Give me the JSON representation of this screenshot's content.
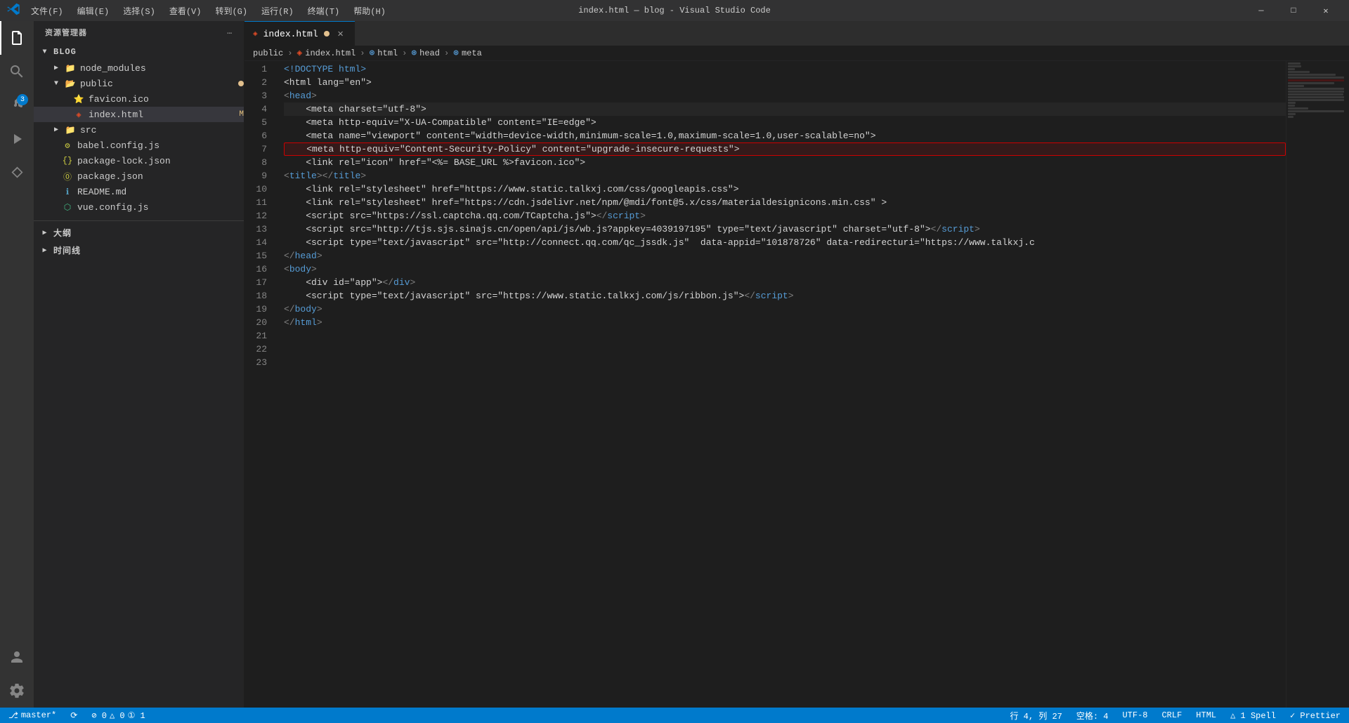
{
  "titleBar": {
    "title": "index.html — blog - Visual Studio Code",
    "menu": [
      "文件(F)",
      "编辑(E)",
      "选择(S)",
      "查看(V)",
      "转到(G)",
      "运行(R)",
      "终端(T)",
      "帮助(H)"
    ],
    "controls": [
      "🗗",
      "❐",
      "✕"
    ]
  },
  "sidebar": {
    "header": "资源管理器",
    "sections": {
      "blog": {
        "label": "BLOG",
        "items": [
          {
            "name": "node_modules",
            "type": "folder",
            "collapsed": true,
            "indent": 1
          },
          {
            "name": "public",
            "type": "folder",
            "collapsed": false,
            "indent": 1,
            "modified": true
          },
          {
            "name": "favicon.ico",
            "type": "file-star",
            "indent": 2
          },
          {
            "name": "index.html",
            "type": "file-html",
            "indent": 2,
            "badge": "M",
            "active": true
          },
          {
            "name": "src",
            "type": "folder",
            "collapsed": true,
            "indent": 1
          },
          {
            "name": "babel.config.js",
            "type": "file-js",
            "indent": 1
          },
          {
            "name": "package-lock.json",
            "type": "file-json",
            "indent": 1
          },
          {
            "name": "package.json",
            "type": "file-json",
            "indent": 1
          },
          {
            "name": "README.md",
            "type": "file-md",
            "indent": 1
          },
          {
            "name": "vue.config.js",
            "type": "file-js",
            "indent": 1
          }
        ]
      }
    }
  },
  "tabs": [
    {
      "name": "index.html",
      "active": true,
      "modified": true,
      "icon": "html"
    }
  ],
  "breadcrumb": {
    "parts": [
      "public",
      "index.html",
      "html",
      "head",
      "meta"
    ]
  },
  "codeLines": [
    {
      "num": 1,
      "content": "<!DOCTYPE html>"
    },
    {
      "num": 2,
      "content": "<html lang=\"en\">"
    },
    {
      "num": 3,
      "content": "  <head>"
    },
    {
      "num": 4,
      "content": "    <meta charset=\"utf-8\">"
    },
    {
      "num": 5,
      "content": "    <meta http-equiv=\"X-UA-Compatible\" content=\"IE=edge\">"
    },
    {
      "num": 6,
      "content": "    <meta name=\"viewport\" content=\"width=device-width,minimum-scale=1.0,maximum-scale=1.0,user-scalable=no\">"
    },
    {
      "num": 7,
      "content": "    <meta http-equiv=\"Content-Security-Policy\" content=\"upgrade-insecure-requests\">",
      "highlight": true
    },
    {
      "num": 8,
      "content": "    <link rel=\"icon\" href=\"<%= BASE_URL %>favicon.ico\">"
    },
    {
      "num": 9,
      "content": "    <title></title>"
    },
    {
      "num": 10,
      "content": "    <link rel=\"stylesheet\" href=\"https://www.static.talkxj.com/css/googleapis.css\">"
    },
    {
      "num": 11,
      "content": "    <link rel=\"stylesheet\" href=\"https://cdn.jsdelivr.net/npm/@mdi/font@5.x/css/materialdesignicons.min.css\" >"
    },
    {
      "num": 12,
      "content": "    <script src=\"https://ssl.captcha.qq.com/TCaptcha.js\"></script>"
    },
    {
      "num": 13,
      "content": "    <script src=\"http://tjs.sjs.sinajs.cn/open/api/js/wb.js?appkey=4039197195\" type=\"text/javascript\" charset=\"utf-8\"></script>"
    },
    {
      "num": 14,
      "content": "    <script type=\"text/javascript\" src=\"http://connect.qq.com/qc_jssdk.js\"  data-appid=\"101878726\" data-redirecturi=\"https://www.talkxj.c"
    },
    {
      "num": 15,
      "content": "  </head>"
    },
    {
      "num": 16,
      "content": "  <body>"
    },
    {
      "num": 17,
      "content": "    <div id=\"app\"></div>"
    },
    {
      "num": 18,
      "content": "    <script type=\"text/javascript\" src=\"https://www.static.talkxj.com/js/ribbon.js\"></script>"
    },
    {
      "num": 19,
      "content": "  </body>"
    },
    {
      "num": 20,
      "content": "</html>"
    },
    {
      "num": 21,
      "content": ""
    },
    {
      "num": 22,
      "content": ""
    },
    {
      "num": 23,
      "content": ""
    }
  ],
  "statusBar": {
    "left": {
      "branch": "master*",
      "sync": "⟳",
      "errors": "⊘ 0",
      "warnings": "△ 0",
      "info": "① 1"
    },
    "right": {
      "position": "行 4, 列 27",
      "spaces": "空格: 4",
      "encoding": "UTF-8",
      "lineEnding": "CRLF",
      "language": "HTML",
      "spell": "△ 1 Spell",
      "prettier": "✓ Prettier"
    }
  }
}
